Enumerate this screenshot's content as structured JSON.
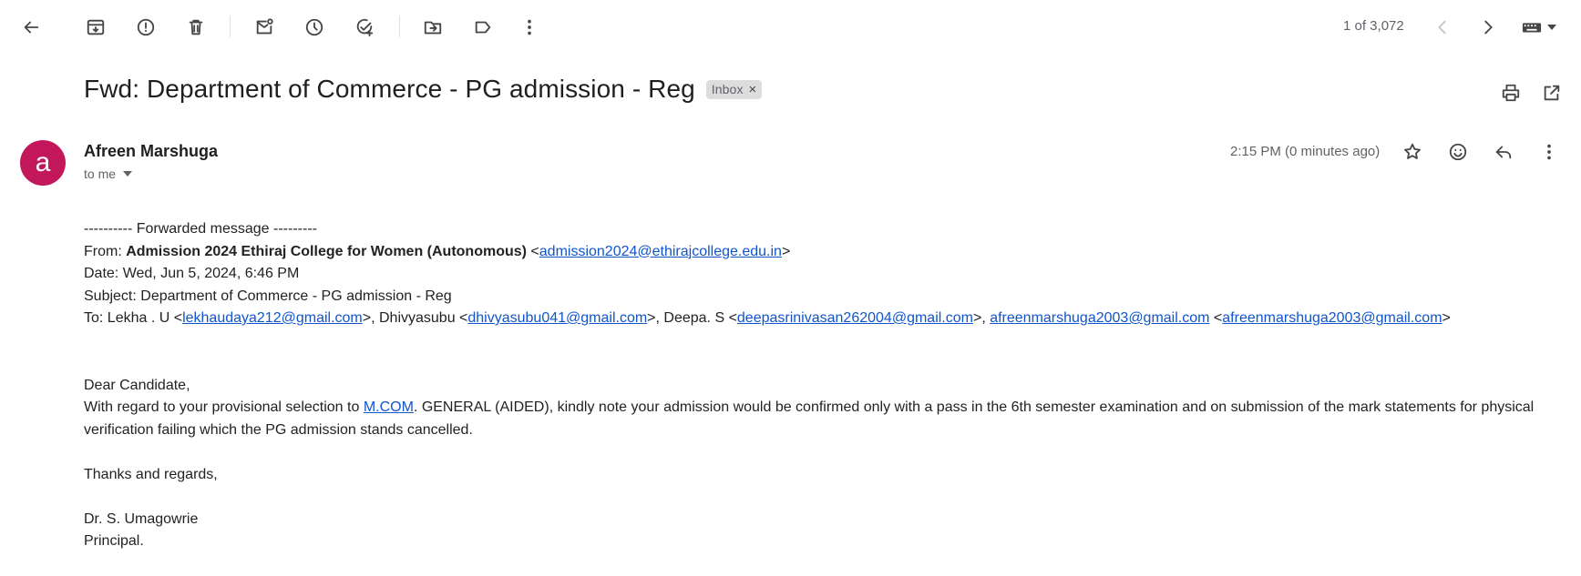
{
  "toolbar": {
    "pager": "1 of 3,072"
  },
  "email": {
    "subject": "Fwd: Department of Commerce - PG admission - Reg",
    "label": "Inbox",
    "label_remove": "×",
    "avatar_letter": "a",
    "avatar_color": "#c2185b",
    "sender": "Afreen Marshuga",
    "to_me": "to me",
    "time": "2:15 PM (0 minutes ago)"
  },
  "fwd": {
    "header": "---------- Forwarded message ---------",
    "from_label": "From: ",
    "from_name": "Admission 2024 Ethiraj College for Women (Autonomous)",
    "lt": " <",
    "from_email": "admission2024@ethirajcollege.edu.in",
    "gt": ">",
    "date": "Date: Wed, Jun 5, 2024, 6:46 PM",
    "subject": "Subject: Department of Commerce - PG admission - Reg",
    "to_label": "To: Lekha . U <",
    "to_email1": "lekhaudaya212@gmail.com",
    "to_sep1": ">, Dhivyasubu <",
    "to_email2": "dhivyasubu041@gmail.com",
    "to_sep2": ">, Deepa. S <",
    "to_email3": "deepasrinivasan262004@gmail.com",
    "to_sep3": ">, ",
    "to_email4": "afreenmarshuga2003@gmail.com",
    "to_sep4": " <",
    "to_email5": "afreenmarshuga2003@gmail.com",
    "to_end": ">"
  },
  "message": {
    "greeting": "Dear Candidate,",
    "p1_pre": "With regard to your provisional selection to ",
    "p1_link": "M.COM",
    "p1_post": ". GENERAL (AIDED), kindly note your admission would be confirmed only with a pass in the 6th semester examination and on submission of the mark statements for physical verification failing which the PG admission stands cancelled.",
    "thanks": "Thanks and regards,",
    "signer": "Dr. S. Umagowrie",
    "title": "Principal."
  },
  "colors": {
    "link": "#1155cc",
    "chip_bg": "#dddddd"
  },
  "icons": [
    "back-arrow-icon",
    "archive-icon",
    "report-spam-icon",
    "delete-icon",
    "mark-unread-icon",
    "snooze-icon",
    "add-to-tasks-icon",
    "move-to-icon",
    "label-icon",
    "more-vert-icon",
    "chevron-left-icon",
    "chevron-right-icon",
    "keyboard-icon",
    "print-icon",
    "open-new-window-icon",
    "star-icon",
    "emoji-icon",
    "reply-icon"
  ]
}
